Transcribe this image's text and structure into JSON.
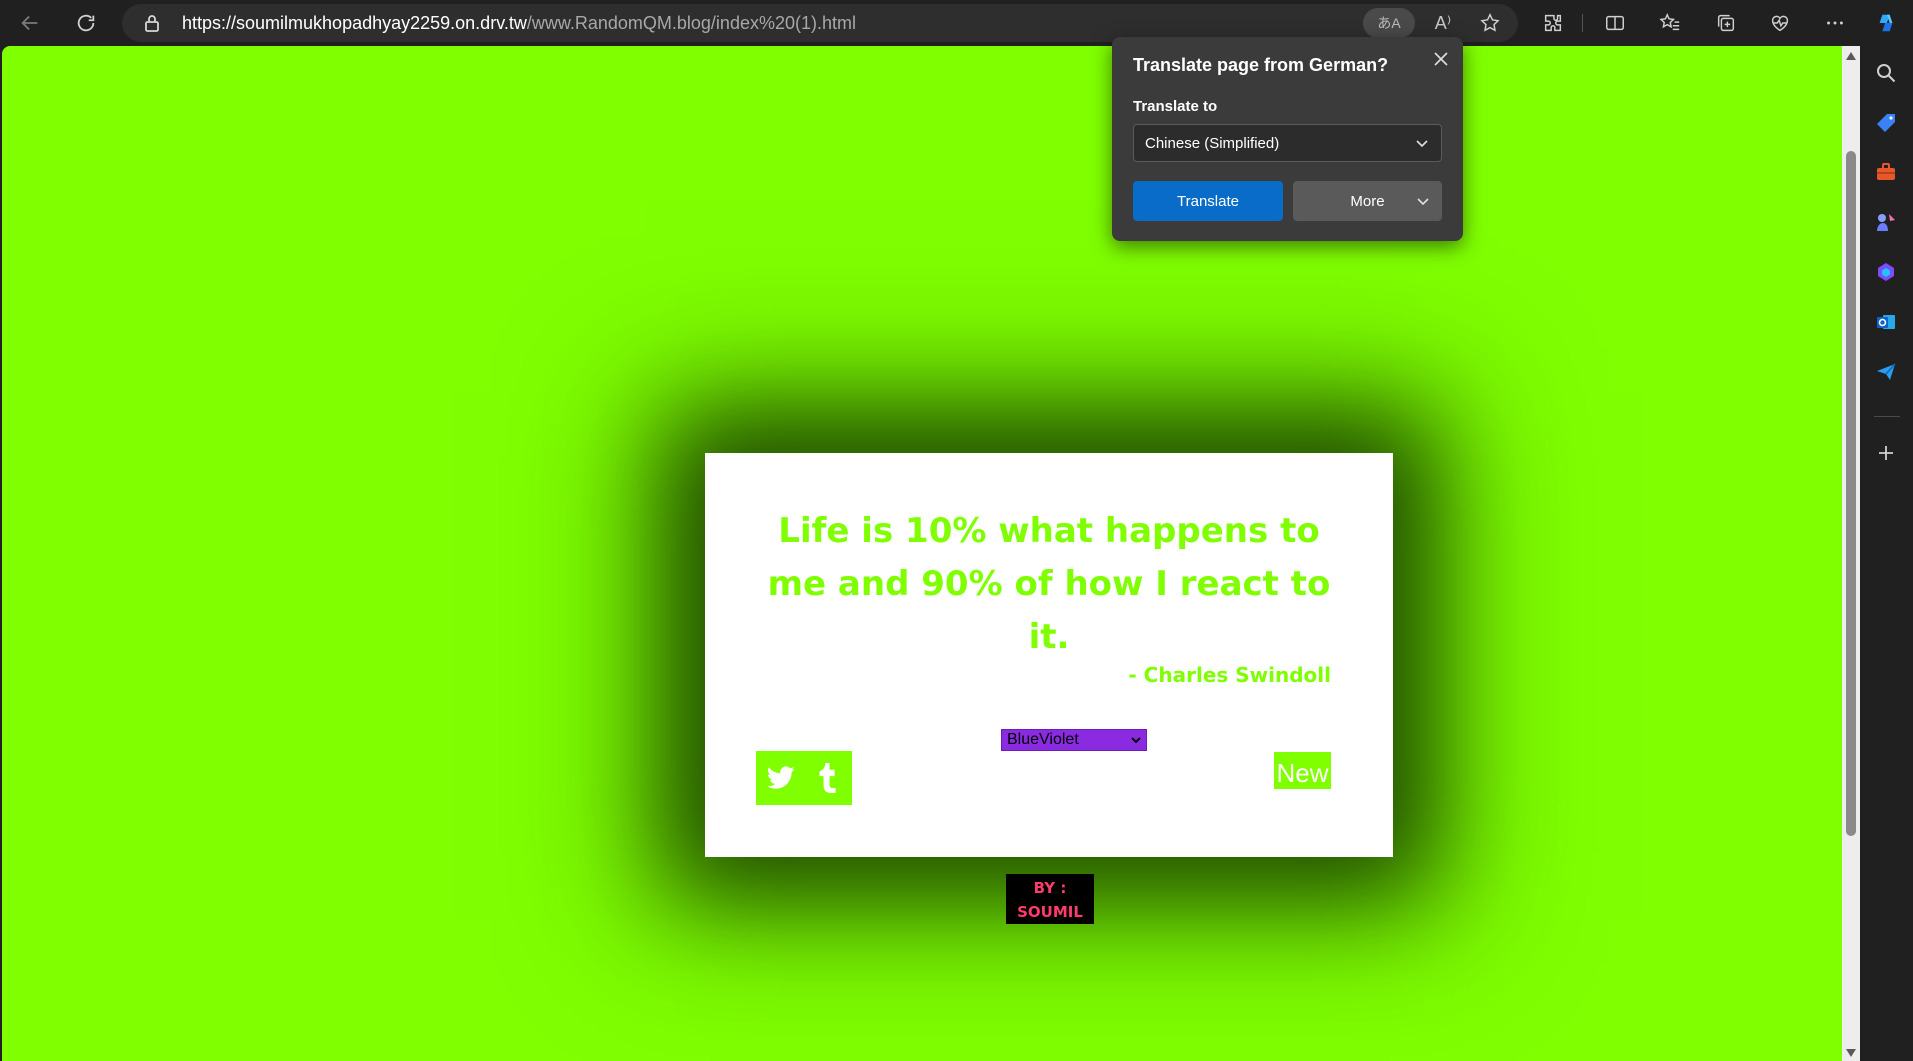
{
  "browser": {
    "url_host": "https://soumilmukhopadhyay2259.on.drv.tw",
    "url_path": "/www.RandomQM.blog/index%20(1).html",
    "translate_pill_glyph": "あA",
    "read_aloud_glyph": "A⁾",
    "icons": [
      "back-icon",
      "refresh-icon",
      "lock-icon",
      "translate-icon",
      "read-aloud-icon",
      "favorite-star-icon",
      "extensions-icon",
      "split-screen-icon",
      "favorites-icon",
      "collections-icon",
      "browser-essentials-icon",
      "more-icon",
      "copilot-icon"
    ]
  },
  "translate_popup": {
    "title": "Translate page from German?",
    "label": "Translate to",
    "selected_language": "Chinese (Simplified)",
    "translate_button": "Translate",
    "more_button": "More",
    "accent_color": "#0a6cc9"
  },
  "page": {
    "background_color": "#7FFF00",
    "quote": "Life is 10% what happens to me and 90% of how I react to it.",
    "author": "- Charles Swindoll",
    "color_select_value": "BlueViolet",
    "color_select_color": "#8A2BE2",
    "share_buttons": [
      "twitter-icon",
      "tumblr-icon"
    ],
    "new_button": "New",
    "byline_line1": "BY :",
    "byline_line2": "SOUMIL"
  },
  "sidebar": {
    "icons": [
      "search-icon",
      "shopping-tag-icon",
      "tools-icon",
      "games-icon",
      "microsoft-365-icon",
      "outlook-icon",
      "send-icon",
      "add-icon"
    ]
  }
}
